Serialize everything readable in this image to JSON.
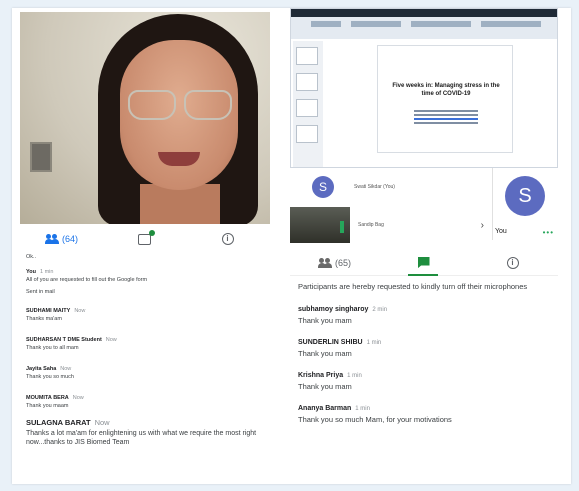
{
  "left_panel": {
    "participants_count": "(64)",
    "chat_intro": "Ok..",
    "messages": [
      {
        "sender": "You",
        "time": "1 min",
        "text": "All of you are requested to fill out the Google form"
      },
      {
        "sender": "",
        "time": "",
        "text": "Sent in mail"
      },
      {
        "sender": "SUDHAMI MAITY",
        "time": "Now",
        "text": "Thanks ma'am"
      },
      {
        "sender": "SUDHARSAN T DME Student",
        "time": "Now",
        "text": "Thank you to all mam"
      },
      {
        "sender": "Jayita Saha",
        "time": "Now",
        "text": "Thank you so much"
      },
      {
        "sender": "MOUMITA BERA",
        "time": "Now",
        "text": "Thank you maam"
      },
      {
        "sender": "SULAGNA BARAT",
        "time": "Now",
        "text": "Thanks a lot ma'am for enlightening us with what we require the most right now...thanks to JIS Biomed Team"
      }
    ]
  },
  "slides": {
    "title": "Five weeks in: Managing stress in the time of COVID-19"
  },
  "participants_strip": {
    "row1_initial": "S",
    "row1_name": "Swati Sikdar (You)",
    "row2_name": "Sandip Bag",
    "row2_chevron": "›",
    "you_initial": "S",
    "you_label": "You",
    "you_dots": "•••"
  },
  "right_panel": {
    "participants_count": "(65)",
    "notice": "Participants are hereby requested to kindly turn off their microphones",
    "messages": [
      {
        "sender": "subhamoy singharoy",
        "time": "2 min",
        "text": "Thank you mam"
      },
      {
        "sender": "SUNDERLIN SHIBU",
        "time": "1 min",
        "text": "Thank you mam"
      },
      {
        "sender": "Krishna Priya",
        "time": "1 min",
        "text": "Thank you mam"
      },
      {
        "sender": "Ananya Barman",
        "time": "1 min",
        "text": "Thank you so much Mam, for your motivations"
      }
    ]
  },
  "colors": {
    "accent_blue": "#1a73e8",
    "accent_green": "#1e8e3e",
    "avatar": "#5c6bc0"
  },
  "icons": [
    "people-icon",
    "chat-icon",
    "info-icon",
    "flag-icon",
    "chevron-right-icon"
  ]
}
